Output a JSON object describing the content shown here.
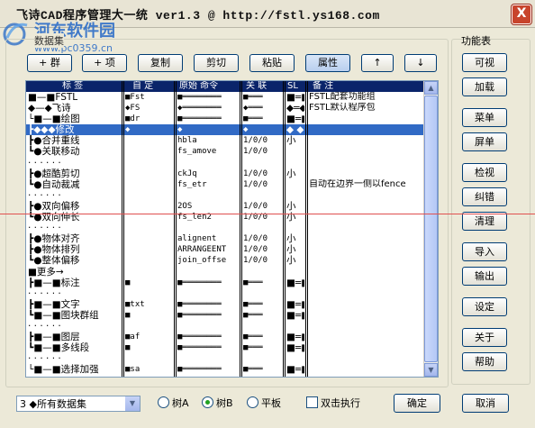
{
  "window": {
    "title": "飞诗CAD程序管理大一统 ver1.3  @ http://fstl.ys168.com",
    "close_label": "X"
  },
  "watermark": {
    "line1": "河东软件园",
    "line2": "www.pc0359.cn"
  },
  "group_caption": "数据集",
  "toolbar": {
    "add_group": "+ 群",
    "add_item": "+ 项",
    "copy": "复制",
    "cut": "剪切",
    "paste": "粘贴",
    "properties": "属性",
    "up": "↑",
    "down": "↓"
  },
  "columns": [
    "标   签",
    "自 定",
    "原始 命令",
    "关 联",
    "SL",
    "备  注"
  ],
  "rows": [
    {
      "tree": "■—■FSTL",
      "alias": "■Fst",
      "orig": "■════════",
      "assoc": "■═══",
      "sl": "■═■",
      "note": "FSTL配套功能组",
      "selected": false
    },
    {
      "tree": "◆—◆飞诗",
      "alias": "◆FS",
      "orig": "◆════════",
      "assoc": "◆═══",
      "sl": "◆═◆",
      "note": "FSTL默认程序包",
      "selected": false
    },
    {
      "tree": "└■—■绘图",
      "alias": "■dr",
      "orig": "■════════",
      "assoc": "■═══",
      "sl": "■═■",
      "note": "",
      "selected": false
    },
    {
      "tree": "┣◆◆◆修改",
      "alias": "◆",
      "orig": "◆",
      "assoc": "◆",
      "sl": "◆ ◆",
      "note": "",
      "selected": true
    },
    {
      "tree": "  ┣●合并重线",
      "alias": "",
      "orig": "hbla",
      "assoc": "1/0/0",
      "sl": "小",
      "note": "",
      "selected": false
    },
    {
      "tree": "  ┗●关联移动",
      "alias": "",
      "orig": "fs_amove",
      "assoc": "1/0/0",
      "sl": "",
      "note": "",
      "selected": false
    },
    {
      "tree": "   · · · · · ·",
      "alias": "",
      "orig": "",
      "assoc": "",
      "sl": "",
      "note": "",
      "selected": false
    },
    {
      "tree": "  ┣●超酷剪切",
      "alias": "",
      "orig": "ckJq",
      "assoc": "1/0/0",
      "sl": "小",
      "note": "",
      "selected": false
    },
    {
      "tree": "  ┗●自动裁减",
      "alias": "",
      "orig": "fs_etr",
      "assoc": "1/0/0",
      "sl": "",
      "note": "自动在边界一侧以fence",
      "selected": false
    },
    {
      "tree": "   · · · · · ·",
      "alias": "",
      "orig": "",
      "assoc": "",
      "sl": "",
      "note": "",
      "selected": false
    },
    {
      "tree": "  ┣●双向偏移",
      "alias": "",
      "orig": "2OS",
      "assoc": "1/0/0",
      "sl": "小",
      "note": "",
      "selected": false
    },
    {
      "tree": "  ┗●双向伸长",
      "alias": "",
      "orig": "fs_len2",
      "assoc": "1/0/0",
      "sl": "小",
      "note": "",
      "selected": false
    },
    {
      "tree": "   · · · · · ·",
      "alias": "",
      "orig": "",
      "assoc": "",
      "sl": "",
      "note": "",
      "selected": false
    },
    {
      "tree": "  ┣●物体对齐",
      "alias": "",
      "orig": "alignent",
      "assoc": "1/0/0",
      "sl": "小",
      "note": "",
      "selected": false
    },
    {
      "tree": "  ┣●物体排列",
      "alias": "",
      "orig": "ARRANGEENT",
      "assoc": "1/0/0",
      "sl": "小",
      "note": "",
      "selected": false
    },
    {
      "tree": "  ┗●整体偏移",
      "alias": "",
      "orig": "join_offse",
      "assoc": "1/0/0",
      "sl": "小",
      "note": "",
      "selected": false
    },
    {
      "tree": "   ■更多→",
      "alias": "",
      "orig": "",
      "assoc": "",
      "sl": "",
      "note": "",
      "selected": false
    },
    {
      "tree": "┣■—■标注",
      "alias": "■",
      "orig": "■════════",
      "assoc": "■═══",
      "sl": "■═■",
      "note": "",
      "selected": false
    },
    {
      "tree": "   · · · · · ·",
      "alias": "",
      "orig": "",
      "assoc": "",
      "sl": "",
      "note": "",
      "selected": false
    },
    {
      "tree": "┣■—■文字",
      "alias": "■txt",
      "orig": "■════════",
      "assoc": "■═══",
      "sl": "■═■",
      "note": "",
      "selected": false
    },
    {
      "tree": "┗■—■图块群组",
      "alias": "■",
      "orig": "■════════",
      "assoc": "■═══",
      "sl": "■═■",
      "note": "",
      "selected": false
    },
    {
      "tree": "   · · · · · ·",
      "alias": "",
      "orig": "",
      "assoc": "",
      "sl": "",
      "note": "",
      "selected": false
    },
    {
      "tree": "┣■—■图层",
      "alias": "■af",
      "orig": "■════════",
      "assoc": "■═══",
      "sl": "■═■",
      "note": "",
      "selected": false
    },
    {
      "tree": "┗■—■多线段",
      "alias": "■",
      "orig": "■════════",
      "assoc": "■═══",
      "sl": "■═■",
      "note": "",
      "selected": false
    },
    {
      "tree": "   · · · · · ·",
      "alias": "",
      "orig": "",
      "assoc": "",
      "sl": "",
      "note": "",
      "selected": false
    },
    {
      "tree": "└■—■选择加强",
      "alias": "■sa",
      "orig": "■════════",
      "assoc": "■═══",
      "sl": "■═■",
      "note": "",
      "selected": false
    }
  ],
  "right_panel": {
    "title": "功能表",
    "buttons": [
      "可视",
      "加载",
      "菜单",
      "屏单",
      "检视",
      "纠错",
      "清理",
      "导入",
      "输出",
      "设定",
      "关于",
      "帮助"
    ]
  },
  "bottom": {
    "dataset_select": "3 ◆所有数据集",
    "radio_tree_a": "树A",
    "radio_tree_b": "树B",
    "radio_flat": "平板",
    "double_click_exec": "双击执行",
    "ok": "确定",
    "cancel": "取消"
  },
  "colors": {
    "selection": "#316ac5",
    "header": "#0a246a",
    "watermark": "#2f6fc8",
    "close": "#c8442c"
  }
}
